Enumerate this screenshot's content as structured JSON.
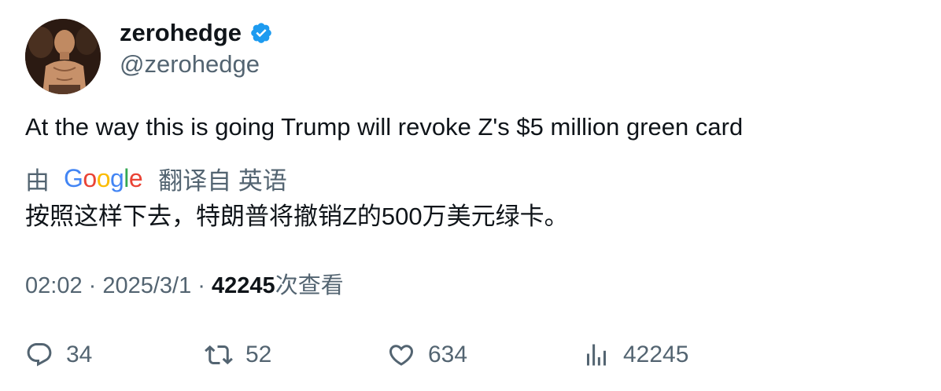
{
  "author": {
    "display_name": "zerohedge",
    "handle": "@zerohedge",
    "verified_color": "#1d9bf0"
  },
  "tweet": {
    "text": "At the way this is going Trump will revoke Z's $5 million green card"
  },
  "translation": {
    "by_label": "由",
    "provider_letters": [
      {
        "ch": "G",
        "color": "#4285F4"
      },
      {
        "ch": "o",
        "color": "#EA4335"
      },
      {
        "ch": "o",
        "color": "#FBBC05"
      },
      {
        "ch": "g",
        "color": "#4285F4"
      },
      {
        "ch": "l",
        "color": "#34A853"
      },
      {
        "ch": "e",
        "color": "#EA4335"
      }
    ],
    "from_label": "翻译自 英语",
    "text": "按照这样下去，特朗普将撤销Z的500万美元绿卡。"
  },
  "meta": {
    "time": "02:02",
    "separator": " · ",
    "date": "2025/3/1",
    "views_count": "42245",
    "views_label": "次查看"
  },
  "actions": {
    "replies": "34",
    "reposts": "52",
    "likes": "634",
    "views": "42245"
  },
  "icons": {
    "reply": "reply-icon",
    "repost": "repost-icon",
    "like": "heart-icon",
    "views": "analytics-icon",
    "verified": "verified-badge-icon"
  }
}
